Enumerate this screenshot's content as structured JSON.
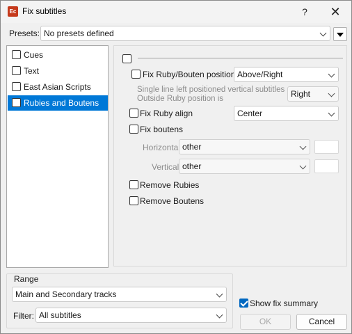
{
  "window": {
    "icon_text": "Ec",
    "title": "Fix subtitles",
    "help_glyph": "?",
    "close_glyph": "✕"
  },
  "presets": {
    "label": "Presets:",
    "value": "No presets defined"
  },
  "categories": [
    {
      "label": "Cues",
      "checked": false,
      "selected": false
    },
    {
      "label": "Text",
      "checked": false,
      "selected": false
    },
    {
      "label": "East Asian Scripts",
      "checked": false,
      "selected": false
    },
    {
      "label": "Rubies and Boutens",
      "checked": false,
      "selected": true
    }
  ],
  "panel": {
    "fix_ruby_bouten_positions": {
      "label": "Fix Ruby/Bouten positions",
      "value": "Above/Right"
    },
    "note_line1": "Single line left positioned vertical subtitles",
    "note_line2": "Outside Ruby position is",
    "outside_ruby_position": {
      "value": "Right"
    },
    "fix_ruby_align": {
      "label": "Fix Ruby align",
      "value": "Center"
    },
    "fix_boutens": {
      "label": "Fix boutens"
    },
    "horizontal": {
      "label": "Horizontal",
      "value": "other"
    },
    "vertical": {
      "label": "Vertical",
      "value": "other"
    },
    "remove_rubies": {
      "label": "Remove Rubies"
    },
    "remove_boutens": {
      "label": "Remove Boutens"
    }
  },
  "range": {
    "label": "Range",
    "tracks_value": "Main and Secondary tracks",
    "filter_label": "Filter:",
    "filter_value": "All subtitles"
  },
  "summary": {
    "label": "Show fix summary",
    "checked": true
  },
  "buttons": {
    "ok": "OK",
    "cancel": "Cancel"
  }
}
